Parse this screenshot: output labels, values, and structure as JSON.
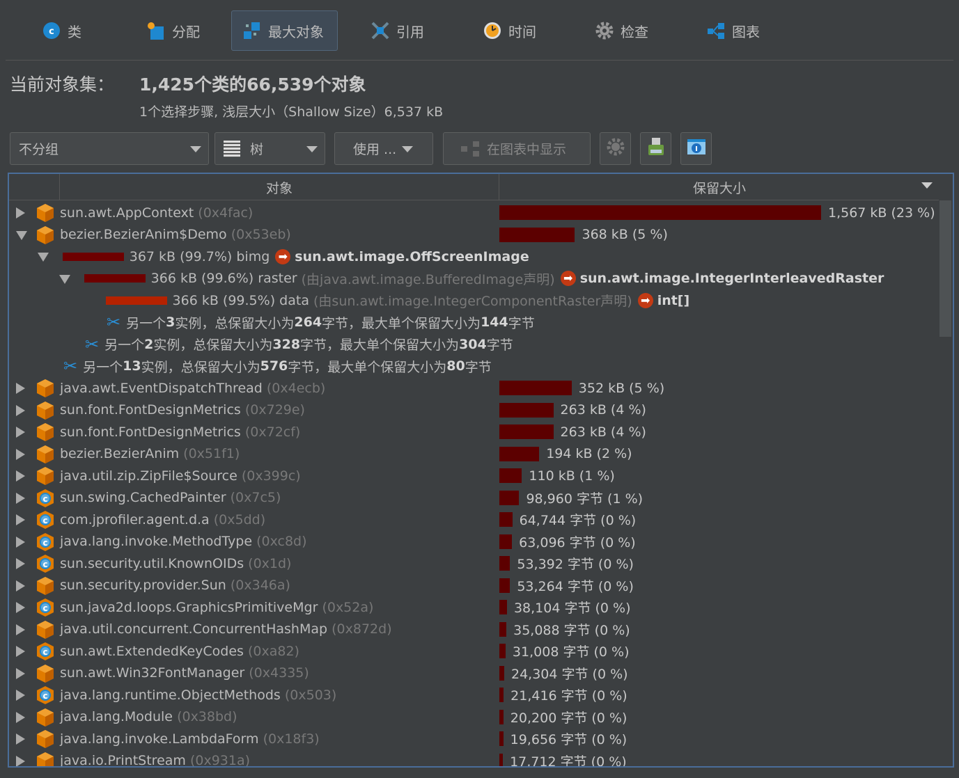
{
  "tabs": [
    {
      "label": "类",
      "icon": "class-icon"
    },
    {
      "label": "分配",
      "icon": "allocation-icon"
    },
    {
      "label": "最大对象",
      "icon": "biggest-objects-icon",
      "selected": true
    },
    {
      "label": "引用",
      "icon": "references-icon"
    },
    {
      "label": "时间",
      "icon": "time-icon"
    },
    {
      "label": "检查",
      "icon": "inspect-icon"
    },
    {
      "label": "图表",
      "icon": "graph-icon"
    }
  ],
  "header": {
    "title": "当前对象集：",
    "value": "1,425个类的66,539个对象",
    "subtitle": "1个选择步骤, 浅层大小（Shallow Size）6,537 kB"
  },
  "toolbar": {
    "grouping": "不分组",
    "view": "树",
    "use": "使用 ...",
    "show_in_graph": "在图表中显示"
  },
  "table": {
    "col_object": "对象",
    "col_retained": "保留大小",
    "colors": {
      "bar": "#5c0000",
      "bar_highlight": "#b52200"
    },
    "rows": [
      {
        "kind": "top",
        "icon": "obj",
        "state": "c",
        "name": "sun.awt.AppContext",
        "addr": "(0x4fac)",
        "kb": 1567,
        "size": "1,567 kB (23 %)"
      },
      {
        "kind": "top",
        "icon": "obj",
        "state": "e",
        "name": "bezier.BezierAnim$Demo",
        "addr": "(0x53eb)",
        "kb": 368,
        "size": "368 kB (5 %)"
      },
      {
        "kind": "ref",
        "depth": 1,
        "state": "e",
        "pct": 99.7,
        "size": "367 kB (99.7%)",
        "field": "bimg",
        "decl": "",
        "target": "sun.awt.image.OffScreenImage"
      },
      {
        "kind": "ref",
        "depth": 2,
        "state": "e",
        "pct": 99.6,
        "size": "366 kB (99.6%)",
        "field": "raster",
        "decl": "(由java.awt.image.BufferedImage声明)",
        "target": "sun.awt.image.IntegerInterleavedRaster"
      },
      {
        "kind": "ref",
        "depth": 3,
        "state": "",
        "pct": 99.5,
        "hl": true,
        "size": "366 kB (99.5%)",
        "field": "data",
        "decl": "(由sun.awt.image.IntegerComponentRaster声明)",
        "target": "int[]"
      },
      {
        "kind": "more",
        "depth": 3,
        "pre": "另一个",
        "n": "3",
        "mid": "实例，总保留大小为",
        "total": "264",
        "mid2": " 字节，最大单个保留大小为",
        "max": "144",
        "post": " 字节"
      },
      {
        "kind": "more",
        "depth": 2,
        "pre": "另一个",
        "n": "2",
        "mid": "实例，总保留大小为",
        "total": "328",
        "mid2": " 字节，最大单个保留大小为",
        "max": "304",
        "post": " 字节"
      },
      {
        "kind": "more",
        "depth": 1,
        "pre": "另一个",
        "n": "13",
        "mid": "实例，总保留大小为",
        "total": "576",
        "mid2": " 字节，最大单个保留大小为",
        "max": "80",
        "post": " 字节"
      },
      {
        "kind": "top",
        "icon": "obj",
        "state": "c",
        "name": "java.awt.EventDispatchThread",
        "addr": "(0x4ecb)",
        "kb": 352,
        "size": "352 kB (5 %)"
      },
      {
        "kind": "top",
        "icon": "obj",
        "state": "c",
        "name": "sun.font.FontDesignMetrics",
        "addr": "(0x729e)",
        "kb": 263,
        "size": "263 kB (4 %)"
      },
      {
        "kind": "top",
        "icon": "obj",
        "state": "c",
        "name": "sun.font.FontDesignMetrics",
        "addr": "(0x72cf)",
        "kb": 263,
        "size": "263 kB (4 %)"
      },
      {
        "kind": "top",
        "icon": "obj",
        "state": "c",
        "name": "bezier.BezierAnim",
        "addr": "(0x51f1)",
        "kb": 194,
        "size": "194 kB (2 %)"
      },
      {
        "kind": "top",
        "icon": "obj",
        "state": "c",
        "name": "java.util.zip.ZipFile$Source",
        "addr": "(0x399c)",
        "kb": 110,
        "size": "110 kB (1 %)"
      },
      {
        "kind": "top",
        "icon": "cls",
        "state": "c",
        "name": "sun.swing.CachedPainter",
        "addr": "(0x7c5)",
        "kb": 96.6,
        "size": "98,960 字节 (1 %)"
      },
      {
        "kind": "top",
        "icon": "cls",
        "state": "c",
        "name": "com.jprofiler.agent.d.a",
        "addr": "(0x5dd)",
        "kb": 63.2,
        "size": "64,744 字节 (0 %)"
      },
      {
        "kind": "top",
        "icon": "cls",
        "state": "c",
        "name": "java.lang.invoke.MethodType",
        "addr": "(0xc8d)",
        "kb": 61.6,
        "size": "63,096 字节 (0 %)"
      },
      {
        "kind": "top",
        "icon": "cls",
        "state": "c",
        "name": "sun.security.util.KnownOIDs",
        "addr": "(0x1d)",
        "kb": 52.1,
        "size": "53,392 字节 (0 %)"
      },
      {
        "kind": "top",
        "icon": "obj",
        "state": "c",
        "name": "sun.security.provider.Sun",
        "addr": "(0x346a)",
        "kb": 52,
        "size": "53,264 字节 (0 %)"
      },
      {
        "kind": "top",
        "icon": "cls",
        "state": "c",
        "name": "sun.java2d.loops.GraphicsPrimitiveMgr",
        "addr": "(0x52a)",
        "kb": 37.2,
        "size": "38,104 字节 (0 %)"
      },
      {
        "kind": "top",
        "icon": "obj",
        "state": "c",
        "name": "java.util.concurrent.ConcurrentHashMap",
        "addr": "(0x872d)",
        "kb": 34.3,
        "size": "35,088 字节 (0 %)"
      },
      {
        "kind": "top",
        "icon": "cls",
        "state": "c",
        "name": "sun.awt.ExtendedKeyCodes",
        "addr": "(0xa82)",
        "kb": 30.3,
        "size": "31,008 字节 (0 %)"
      },
      {
        "kind": "top",
        "icon": "obj",
        "state": "c",
        "name": "sun.awt.Win32FontManager",
        "addr": "(0x4335)",
        "kb": 23.7,
        "size": "24,304 字节 (0 %)"
      },
      {
        "kind": "top",
        "icon": "cls",
        "state": "c",
        "name": "java.lang.runtime.ObjectMethods",
        "addr": "(0x503)",
        "kb": 20.9,
        "size": "21,416 字节 (0 %)"
      },
      {
        "kind": "top",
        "icon": "obj",
        "state": "c",
        "name": "java.lang.Module",
        "addr": "(0x38bd)",
        "kb": 19.7,
        "size": "20,200 字节 (0 %)"
      },
      {
        "kind": "top",
        "icon": "obj",
        "state": "c",
        "name": "java.lang.invoke.LambdaForm",
        "addr": "(0x18f3)",
        "kb": 19.2,
        "size": "19,656 字节 (0 %)"
      },
      {
        "kind": "top",
        "icon": "obj",
        "state": "c",
        "name": "java.io.PrintStream",
        "addr": "(0x931a)",
        "kb": 17.3,
        "size": "17,712 字节 (0 %)"
      }
    ]
  }
}
